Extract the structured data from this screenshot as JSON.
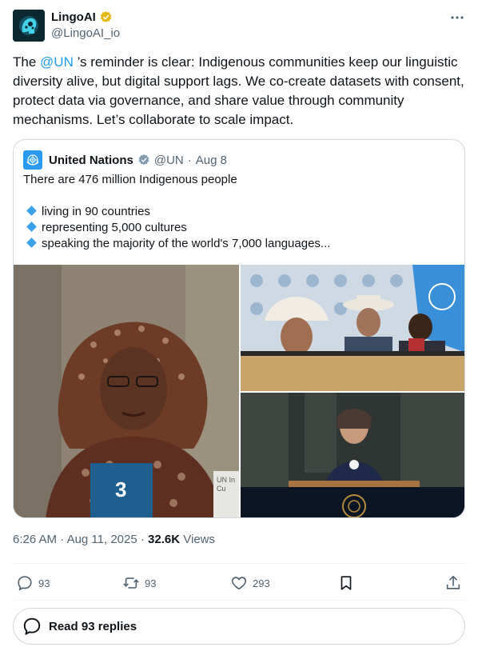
{
  "author": {
    "display_name": "LingoAI",
    "handle": "@LingoAI_io",
    "verified_color": "#e2b719"
  },
  "tweet": {
    "text_before": "The ",
    "mention": "@UN",
    "text_after": " ’s reminder is clear: Indigenous communities keep our linguistic diversity alive, but digital support lags. We co-create datasets with consent, protect data via governance, and share value through community mechanisms. Let’s collaborate to scale impact."
  },
  "quote": {
    "display_name": "United Nations",
    "handle": "@UN",
    "separator": "·",
    "date": "Aug 8",
    "verified_color": "#829aab",
    "lead": "There are 476 million Indigenous people",
    "bullets": [
      "living in 90 countries",
      "representing 5,000 cultures",
      "speaking the majority of the world's 7,000 languages..."
    ],
    "media_left_placard": "3",
    "media_left_sign": "UN In\nCu"
  },
  "meta": {
    "time": "6:26 AM",
    "dot1": "·",
    "date": "Aug 11, 2025",
    "dot2": "·",
    "views_count": "32.6K",
    "views_label": "Views"
  },
  "actions": {
    "replies": "93",
    "reposts": "93",
    "likes": "293"
  },
  "read_replies": "Read 93 replies",
  "colors": {
    "accent": "#1d9bf0",
    "text": "#0f1419",
    "secondary": "#536471",
    "border": "#cfd9de"
  }
}
